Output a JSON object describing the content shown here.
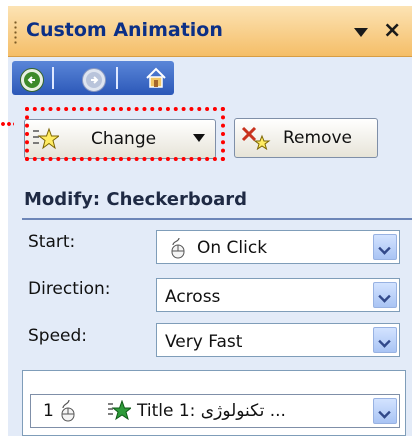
{
  "pane": {
    "title": "Custom Animation",
    "menu_icon": "dropdown-arrow-icon",
    "close_label": "×"
  },
  "nav": {
    "back_icon": "back-arrow-icon",
    "forward_icon": "forward-arrow-icon",
    "home_icon": "home-icon"
  },
  "toolbar": {
    "change_label": "Change",
    "change_icon": "star-effect-icon",
    "remove_label": "Remove",
    "remove_icon": "remove-effect-icon"
  },
  "modify": {
    "heading": "Modify: Checkerboard",
    "start_label": "Start:",
    "start_value": "On Click",
    "direction_label": "Direction:",
    "direction_value": "Across",
    "speed_label": "Speed:",
    "speed_value": "Very Fast"
  },
  "effects_list": {
    "items": [
      {
        "order": "1",
        "text": "Title 1: تکنولوژی ..."
      }
    ]
  },
  "colors": {
    "titlebar": "#f5be68",
    "title_text": "#0b2f86",
    "pane_bg": "#e3ebf8",
    "highlight": "#ff0000"
  }
}
